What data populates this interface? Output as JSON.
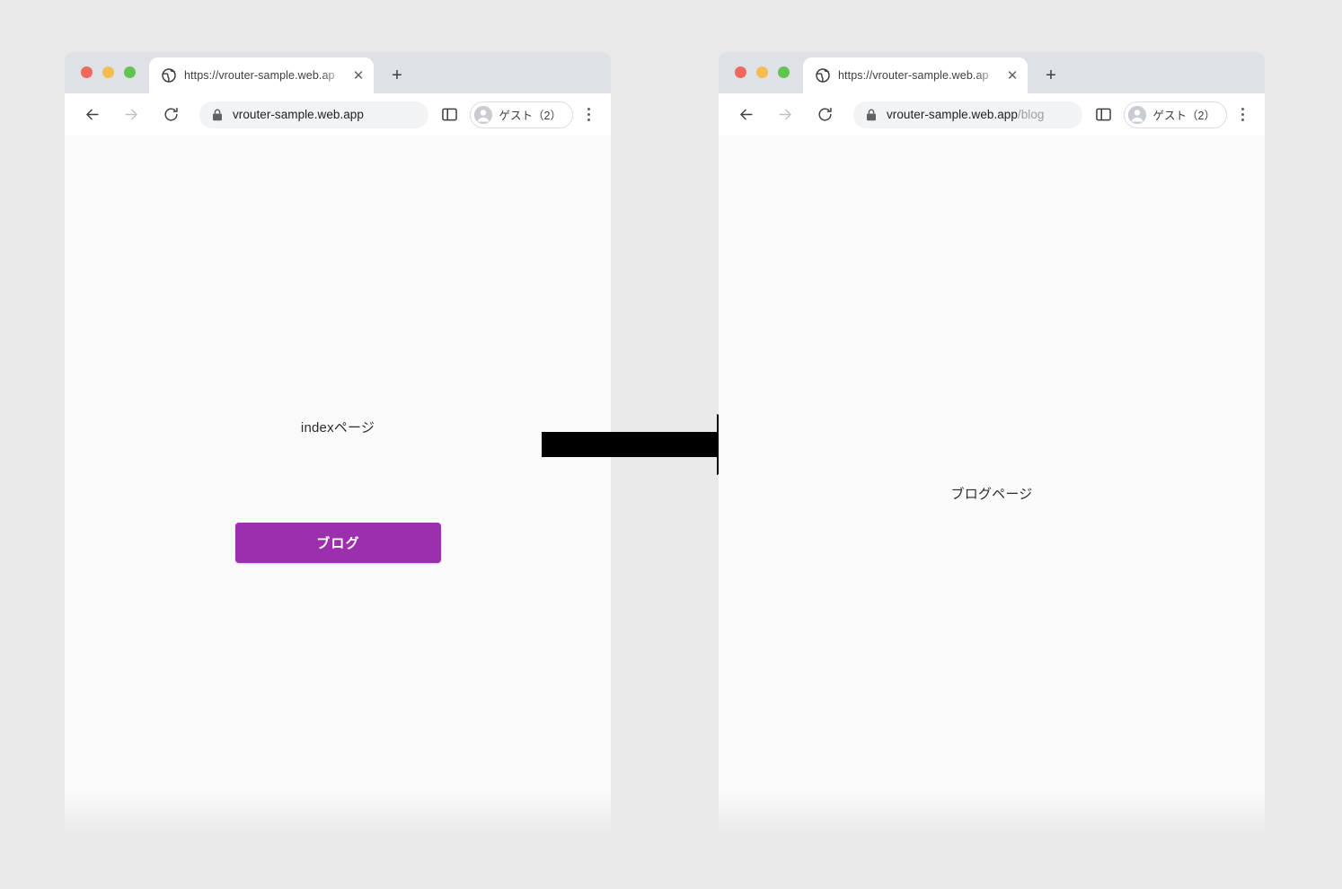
{
  "background_color": "#eaeaea",
  "windows": [
    {
      "id": "left",
      "traffic_lights": {
        "close": "close-window",
        "minimize": "minimize-window",
        "zoom": "zoom-window"
      },
      "tab": {
        "favicon": "globe-icon",
        "title": "https://vrouter-sample.web.ap",
        "close_label": "✕"
      },
      "new_tab_label": "+",
      "toolbar": {
        "back_label": "back",
        "forward_label": "forward",
        "reload_label": "reload",
        "lock_icon": "lock-icon",
        "url_domain": "vrouter-sample.web.app",
        "url_path": "",
        "side_panel_icon": "side-panel-icon",
        "profile_label": "ゲスト（2）",
        "profile_icon": "account-circle-icon",
        "menu_icon": "kebab-menu-icon"
      },
      "page": {
        "heading": "indexページ",
        "button_label": "ブログ",
        "button_color": "#9c2fae",
        "background": "#fafafa"
      }
    },
    {
      "id": "right",
      "traffic_lights": {
        "close": "close-window",
        "minimize": "minimize-window",
        "zoom": "zoom-window"
      },
      "tab": {
        "favicon": "globe-icon",
        "title": "https://vrouter-sample.web.ap",
        "close_label": "✕"
      },
      "new_tab_label": "+",
      "toolbar": {
        "back_label": "back",
        "forward_label": "forward",
        "reload_label": "reload",
        "lock_icon": "lock-icon",
        "url_domain": "vrouter-sample.web.app",
        "url_path": "/blog",
        "side_panel_icon": "side-panel-icon",
        "profile_label": "ゲスト（2）",
        "profile_icon": "account-circle-icon",
        "menu_icon": "kebab-menu-icon"
      },
      "page": {
        "heading": "ブログページ",
        "button_label": "",
        "button_color": "",
        "background": "#fafafa"
      }
    }
  ],
  "arrow": {
    "name": "transition-arrow",
    "direction": "right",
    "color": "#000000"
  }
}
